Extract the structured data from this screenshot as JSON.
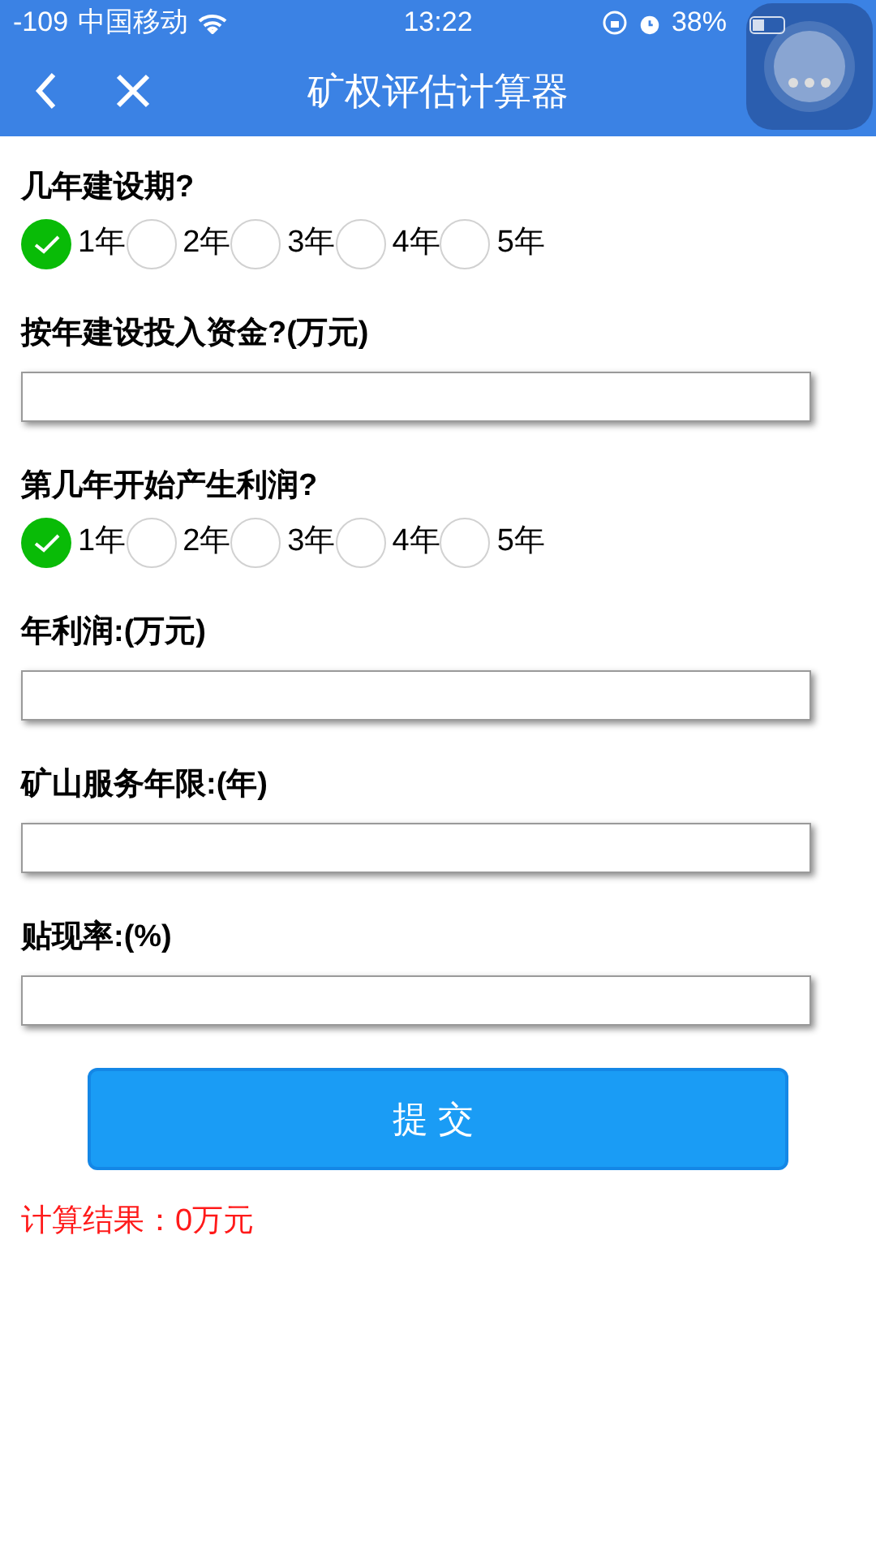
{
  "status_bar": {
    "signal": "-109",
    "carrier": "中国移动",
    "time": "13:22",
    "battery": "38%"
  },
  "nav": {
    "title": "矿权评估计算器"
  },
  "fields": [
    {
      "kind": "radio",
      "label": "几年建设期?",
      "options": [
        {
          "label": "1年",
          "selected": true
        },
        {
          "label": "2年",
          "selected": false
        },
        {
          "label": "3年",
          "selected": false
        },
        {
          "label": "4年",
          "selected": false
        },
        {
          "label": "5年",
          "selected": false
        }
      ]
    },
    {
      "kind": "input",
      "label": "按年建设投入资金?(万元)"
    },
    {
      "kind": "radio",
      "label": "第几年开始产生利润?",
      "options": [
        {
          "label": "1年",
          "selected": true
        },
        {
          "label": "2年",
          "selected": false
        },
        {
          "label": "3年",
          "selected": false
        },
        {
          "label": "4年",
          "selected": false
        },
        {
          "label": "5年",
          "selected": false
        }
      ]
    },
    {
      "kind": "input",
      "label": "年利润:(万元)"
    },
    {
      "kind": "input",
      "label": "矿山服务年限:(年)"
    },
    {
      "kind": "input",
      "label": "贴现率:(%)"
    }
  ],
  "submit": "提交",
  "result": "计算结果：0万元"
}
